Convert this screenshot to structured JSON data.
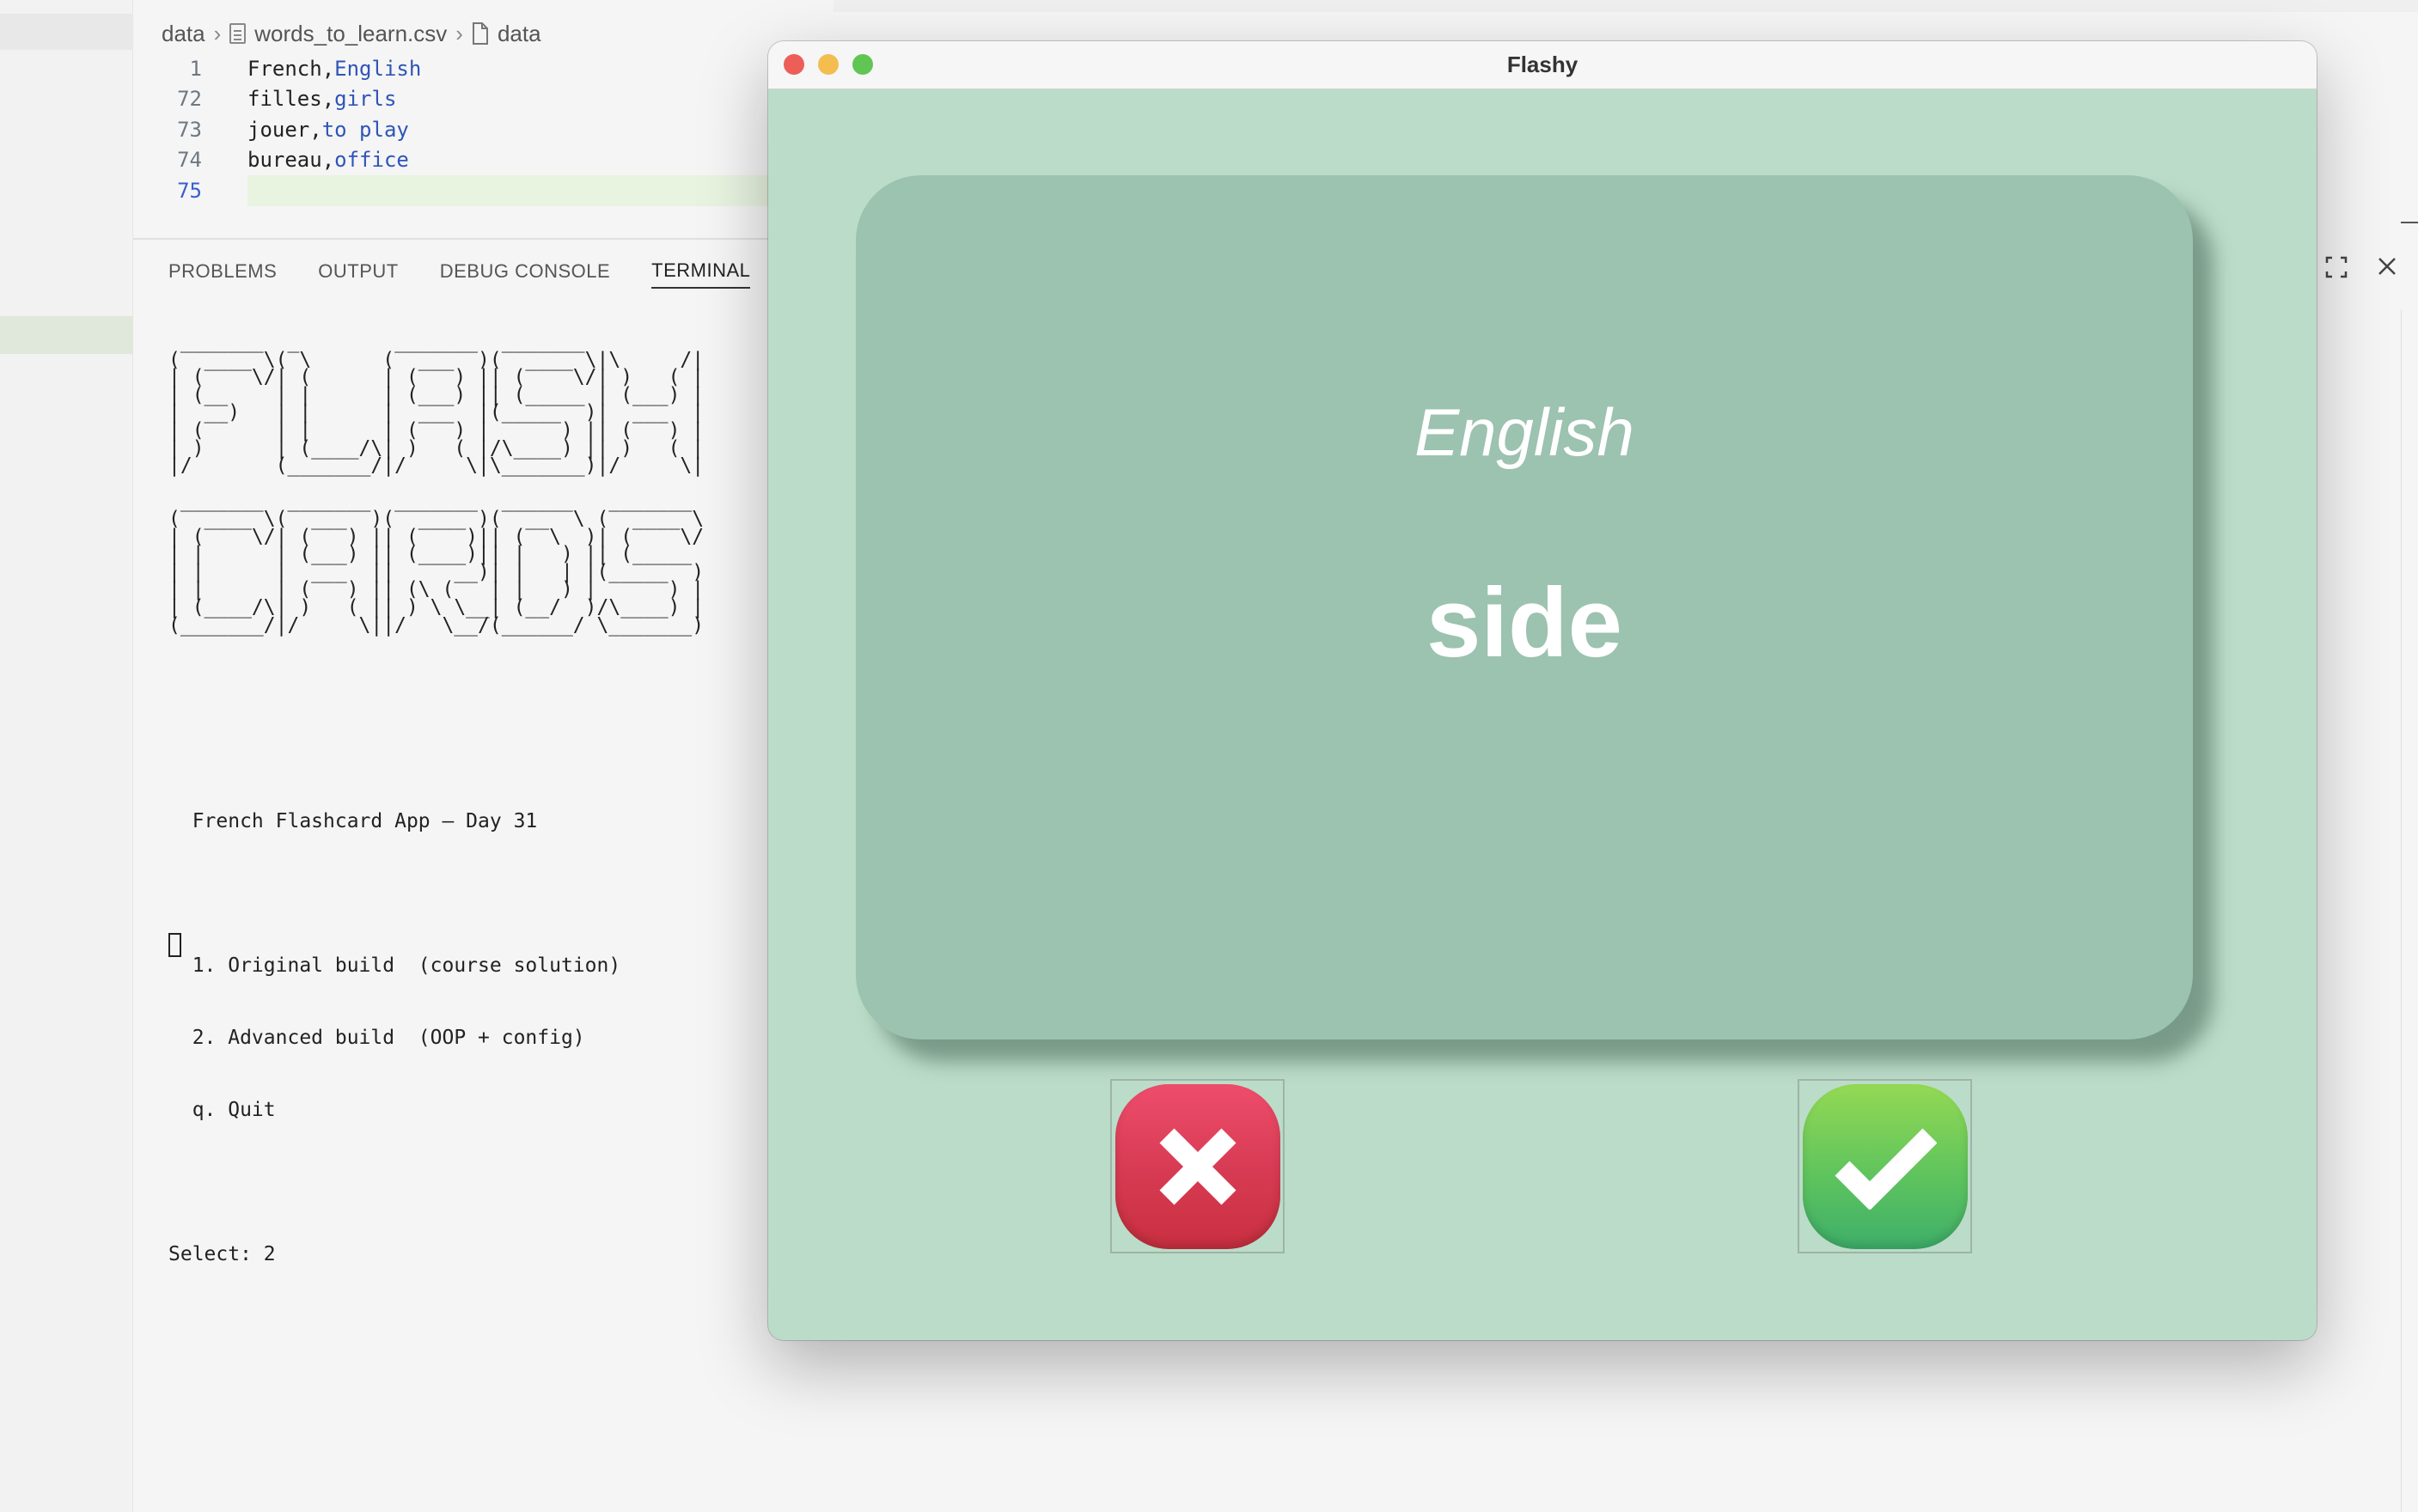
{
  "editor": {
    "breadcrumb": [
      "data",
      "words_to_learn.csv",
      "data"
    ],
    "code_lines": [
      {
        "num": "1",
        "key": "French,",
        "value": "English"
      },
      {
        "num": "72",
        "key": "filles,",
        "value": "girls"
      },
      {
        "num": "73",
        "key": "jouer,",
        "value": "to play"
      },
      {
        "num": "74",
        "key": "bureau,",
        "value": "office"
      },
      {
        "num": "75",
        "key": "",
        "value": ""
      }
    ]
  },
  "panel": {
    "tabs": [
      "PROBLEMS",
      "OUTPUT",
      "DEBUG CONSOLE",
      "TERMINAL"
    ],
    "active_tab": "TERMINAL",
    "tool_icons": [
      "maximize-icon",
      "close-icon"
    ]
  },
  "terminal": {
    "ascii_art": " _______  _        _______  _______          \n(  ____ \\( \\      (  ___  )(  ____ \\|\\     /|\n| (    \\/| (      | (   ) || (    \\/| )   ( |\n| (__    | |      | (___) || (_____ | (___) |\n|  __)   | |      |  ___  |(_____  )|  ___  |\n| (      | |      | (   ) |      ) || (   ) |\n| )      | (____/\\| )   ( |/\\____) || )   ( |\n|/       (_______/|/     \\|\\_______)|/     \\|\n\n _______  _______  _______  ______   _______ \n(  ____ \\(  ___  )(  ____ )(  __  \\ (  ____ \\\n| (    \\/| (   ) || (    )|| (  \\  )| (    \\/\n| |      | (___) || (____)|| |   ) || (_____ \n| |      |  ___  ||     __)| |   | |(_____  )\n| |      | (   ) || (\\ (   | |   ) |      ) |\n| (____/\\| )   ( || ) \\ \\__| (__/  )/\\____) |\n(_______/|/     \\||/   \\__/(______/ \\_______)",
    "lines": [
      "  French Flashcard App — Day 31",
      "",
      "  1. Original build  (course solution)",
      "  2. Advanced build  (OOP + config)",
      "  q. Quit",
      "",
      "Select: 2"
    ]
  },
  "flashy": {
    "window_title": "Flashy",
    "traffic_lights": {
      "close": "#ed5e58",
      "minimize": "#f4bd4f",
      "zoom": "#61c554"
    },
    "card": {
      "title": "English",
      "word": "side",
      "color": "#9cc2b0"
    },
    "background_color": "#bbdcc8",
    "wrong_button_icon": "x-icon",
    "right_button_icon": "checkmark-icon"
  }
}
